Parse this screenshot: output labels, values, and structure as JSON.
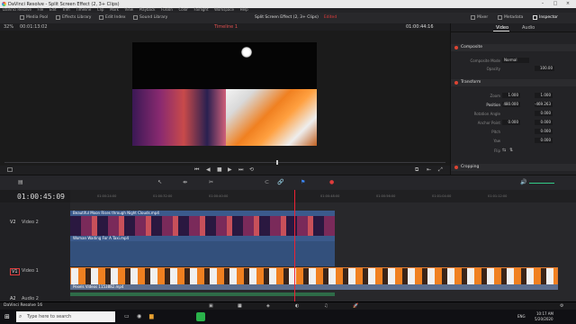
{
  "window": {
    "title": "DaVinci Resolve - Split Screen Effect (2, 3+ Clips)"
  },
  "menu": [
    "DaVinci Resolve",
    "File",
    "Edit",
    "Trim",
    "Timeline",
    "Clip",
    "Mark",
    "View",
    "Playback",
    "Fusion",
    "Color",
    "Fairlight",
    "Workspace",
    "Help"
  ],
  "toolbar": {
    "media_pool": "Media Pool",
    "effects_library": "Effects Library",
    "edit_index": "Edit Index",
    "sound_library": "Sound Library",
    "project_title": "Split Screen Effect (2, 3+ Clips)",
    "edited": "Edited",
    "mixer": "Mixer",
    "metadata": "Metadata",
    "inspector": "Inspector"
  },
  "viewer": {
    "zoom": "32%",
    "source_tc": "00:01:13:02",
    "timeline_name": "Timeline 1",
    "record_tc": "01:00:44:16"
  },
  "inspector": {
    "tabs": [
      "Video",
      "Audio"
    ],
    "composite": {
      "title": "Composite",
      "mode_label": "Composite Mode",
      "mode_value": "Normal",
      "opacity_label": "Opacity",
      "opacity_value": "100.00"
    },
    "transform": {
      "title": "Transform",
      "zoom_label": "Zoom",
      "zoom_x": "1.000",
      "zoom_y": "1.000",
      "position_label": "Position",
      "pos_x": "480.000",
      "pos_y": "-469.263",
      "rotation_label": "Rotation Angle",
      "rotation_value": "0.000",
      "anchor_label": "Anchor Point",
      "anchor_x": "0.000",
      "anchor_y": "0.000",
      "pitch_label": "Pitch",
      "pitch_value": "0.000",
      "yaw_label": "Yaw",
      "yaw_value": "0.000",
      "flip_label": "Flip"
    },
    "cropping": {
      "title": "Cropping"
    }
  },
  "timeline": {
    "timecode": "01:00:45:09",
    "ruler": [
      "01:00:24:00",
      "01:00:32:00",
      "01:00:40:00",
      "01:00:48:00",
      "01:00:56:00",
      "01:01:04:00",
      "01:01:12:00"
    ],
    "tracks": [
      {
        "id": "V2",
        "name": "Video 2",
        "clip": "Beautiful Moon Rises through Night Clouds.mp4"
      },
      {
        "id": "",
        "name": "",
        "clip": "Woman Waiting For A Taxi.mp4"
      },
      {
        "id": "V1",
        "name": "Video 1",
        "clip": "Pexels Videos 1153882.mp4"
      },
      {
        "id": "A2",
        "name": "Audio 2",
        "clip": ""
      }
    ]
  },
  "taskbar": {
    "search_placeholder": "Type here to search",
    "app": "DaVinci Resolve 16",
    "time": "10:17 AM",
    "date": "5/20/2020",
    "lang": "ENG"
  },
  "colors": {
    "accent": "#e03c3c",
    "clip_blue": "#3b5a8c",
    "clip_v1": "#5c6e8e"
  }
}
